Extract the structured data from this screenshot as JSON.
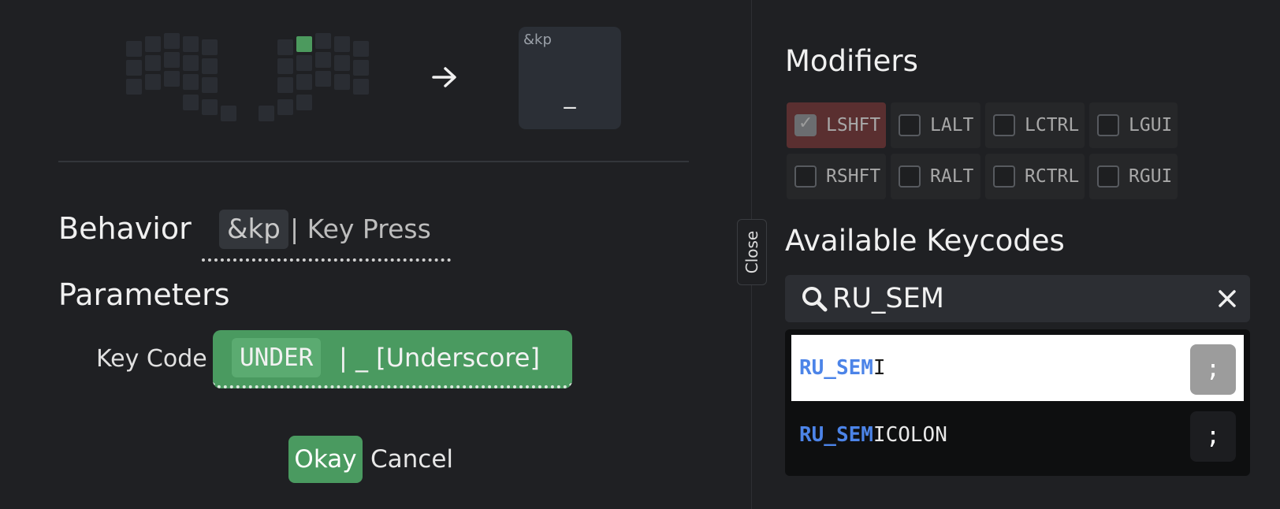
{
  "preview": {
    "arrow_icon": "arrow-right-icon",
    "key_label": "&kp",
    "key_value": "_"
  },
  "behavior": {
    "label": "Behavior",
    "code": "&kp",
    "name": "| Key Press"
  },
  "parameters": {
    "label": "Parameters",
    "keycode_label": "Key Code",
    "keycode_code": "UNDER",
    "keycode_name": "| _ [Underscore]"
  },
  "actions": {
    "okay_label": "Okay",
    "cancel_label": "Cancel"
  },
  "close_tab": {
    "label": "Close"
  },
  "modifiers": {
    "title": "Modifiers",
    "items": [
      {
        "label": "LSHFT",
        "checked": true
      },
      {
        "label": "LALT",
        "checked": false
      },
      {
        "label": "LCTRL",
        "checked": false
      },
      {
        "label": "LGUI",
        "checked": false
      },
      {
        "label": "RSHFT",
        "checked": false
      },
      {
        "label": "RALT",
        "checked": false
      },
      {
        "label": "RCTRL",
        "checked": false
      },
      {
        "label": "RGUI",
        "checked": false
      }
    ]
  },
  "keycodes": {
    "title": "Available Keycodes",
    "search_value": "RU_SEM",
    "search_icon": "search-icon",
    "clear_icon": "close-icon",
    "results": [
      {
        "match": "RU_SEM",
        "rest": "I",
        "key": ";",
        "selected": true
      },
      {
        "match": "RU_SEM",
        "rest": "ICOLON",
        "key": ";",
        "selected": false
      }
    ]
  },
  "colors": {
    "accent_green": "#4a9a60",
    "match_blue": "#4c84e8",
    "modifier_checked": "#5a2f30"
  }
}
